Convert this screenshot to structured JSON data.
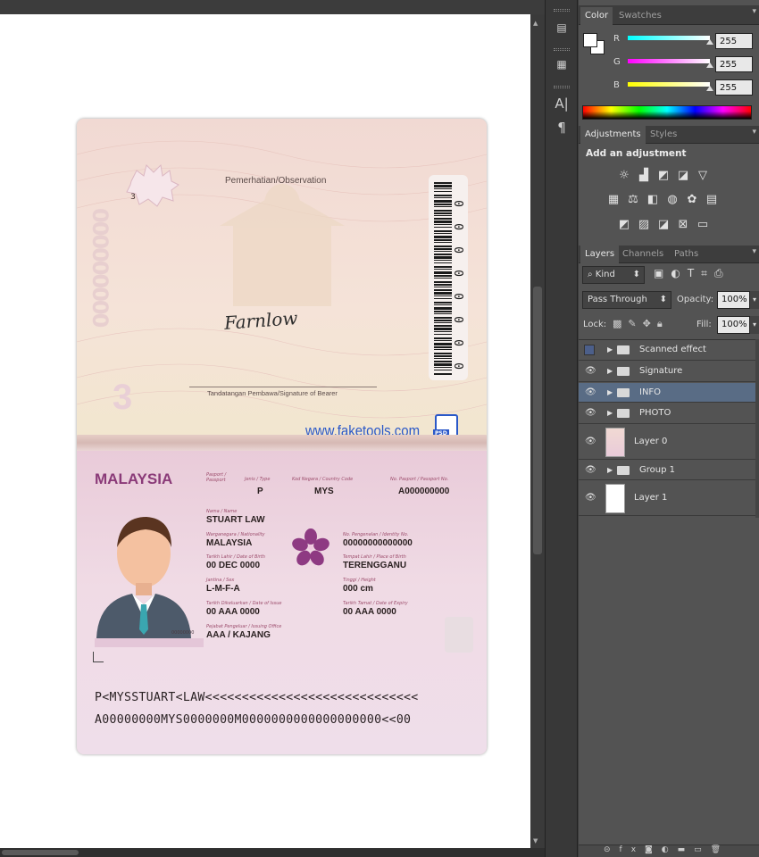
{
  "app": {
    "name": "Photoshop"
  },
  "color_panel": {
    "tabs": [
      "Color",
      "Swatches"
    ],
    "channels": [
      {
        "label": "R",
        "value": "255"
      },
      {
        "label": "G",
        "value": "255"
      },
      {
        "label": "B",
        "value": "255"
      }
    ],
    "colors": {
      "r": "#30d8d8",
      "g": "#d030d8",
      "b": "#e0e030"
    }
  },
  "adjustments_panel": {
    "tabs": [
      "Adjustments",
      "Styles"
    ],
    "heading": "Add an adjustment",
    "icons": [
      "brightness-icon",
      "levels-icon",
      "curves-icon",
      "exposure-icon",
      "vibrance-icon",
      "hue-saturation-icon",
      "color-balance-icon",
      "black-white-icon",
      "photo-filter-icon",
      "channel-mixer-icon",
      "color-lookup-icon",
      "invert-icon",
      "posterize-icon",
      "threshold-icon",
      "selective-color-icon",
      "gradient-map-icon"
    ]
  },
  "layers_panel": {
    "tabs": [
      "Layers",
      "Channels",
      "Paths"
    ],
    "filter_kind": "Kind",
    "blend_mode": "Pass Through",
    "opacity_label": "Opacity:",
    "opacity_value": "100%",
    "lock_label": "Lock:",
    "fill_label": "Fill:",
    "fill_value": "100%",
    "layers": [
      {
        "name": "Scanned effect",
        "type": "group",
        "visible": false,
        "selected": false
      },
      {
        "name": "Signature",
        "type": "group",
        "visible": true,
        "selected": false
      },
      {
        "name": "INFO",
        "type": "group",
        "visible": true,
        "selected": true
      },
      {
        "name": "PHOTO",
        "type": "group",
        "visible": true,
        "selected": false
      },
      {
        "name": "Layer 0",
        "type": "layer",
        "visible": true,
        "selected": false
      },
      {
        "name": "Group 1",
        "type": "group",
        "visible": true,
        "selected": false
      },
      {
        "name": "Layer 1",
        "type": "layer",
        "visible": true,
        "selected": false
      }
    ]
  },
  "document": {
    "page_number": "3",
    "observation": "Pemerhatian/Observation",
    "signature_caption": "Tandatangan Pembawa/Signature of Bearer",
    "signature_text": "Farnlow",
    "watermark": "www.faketools.com",
    "watermark_badge": "PSD",
    "perforation": "000000000",
    "country_title": "MALAYSIA",
    "fields": {
      "passport_cap": "Pasport / Passport",
      "type_cap": "Jenis / Type",
      "type": "P",
      "country_cap": "Kod Negara / Country Code",
      "country": "MYS",
      "passport_no_cap": "No. Pasport / Passport No.",
      "passport_no": "A000000000",
      "name_cap": "Nama / Name",
      "name": "STUART LAW",
      "nationality_cap": "Warganegara / Nationality",
      "nationality": "MALAYSIA",
      "id_cap": "No. Pengenalan / Identity No.",
      "id": "00000000000000",
      "dob_cap": "Tarikh Lahir / Date of Birth",
      "dob": "00 DEC 0000",
      "pob_cap": "Tempat Lahir / Place of Birth",
      "pob": "TERENGGANU",
      "sex_cap": "Jantina / Sex",
      "sex": "L-M-F-A",
      "height_cap": "Tinggi / Height",
      "height": "000 cm",
      "issue_cap": "Tarikh Dikeluarkan / Date of Issue",
      "issue": "00 AAA 0000",
      "expiry_cap": "Tarikh Tamat / Date of Expiry",
      "expiry": "00 AAA 0000",
      "office_cap": "Pejabat Pengeluar / Issuing Office",
      "office": "AAA / KAJANG",
      "photo_number": "00000000"
    },
    "mrz_line1": "P<MYSSTUART<LAW<<<<<<<<<<<<<<<<<<<<<<<<<<<<<",
    "mrz_line2": "A00000000MYS0000000M0000000000000000000<<00",
    "barcode_digits": [
      "0",
      "0",
      "0",
      "0",
      "0",
      "0",
      "0",
      "0"
    ]
  }
}
